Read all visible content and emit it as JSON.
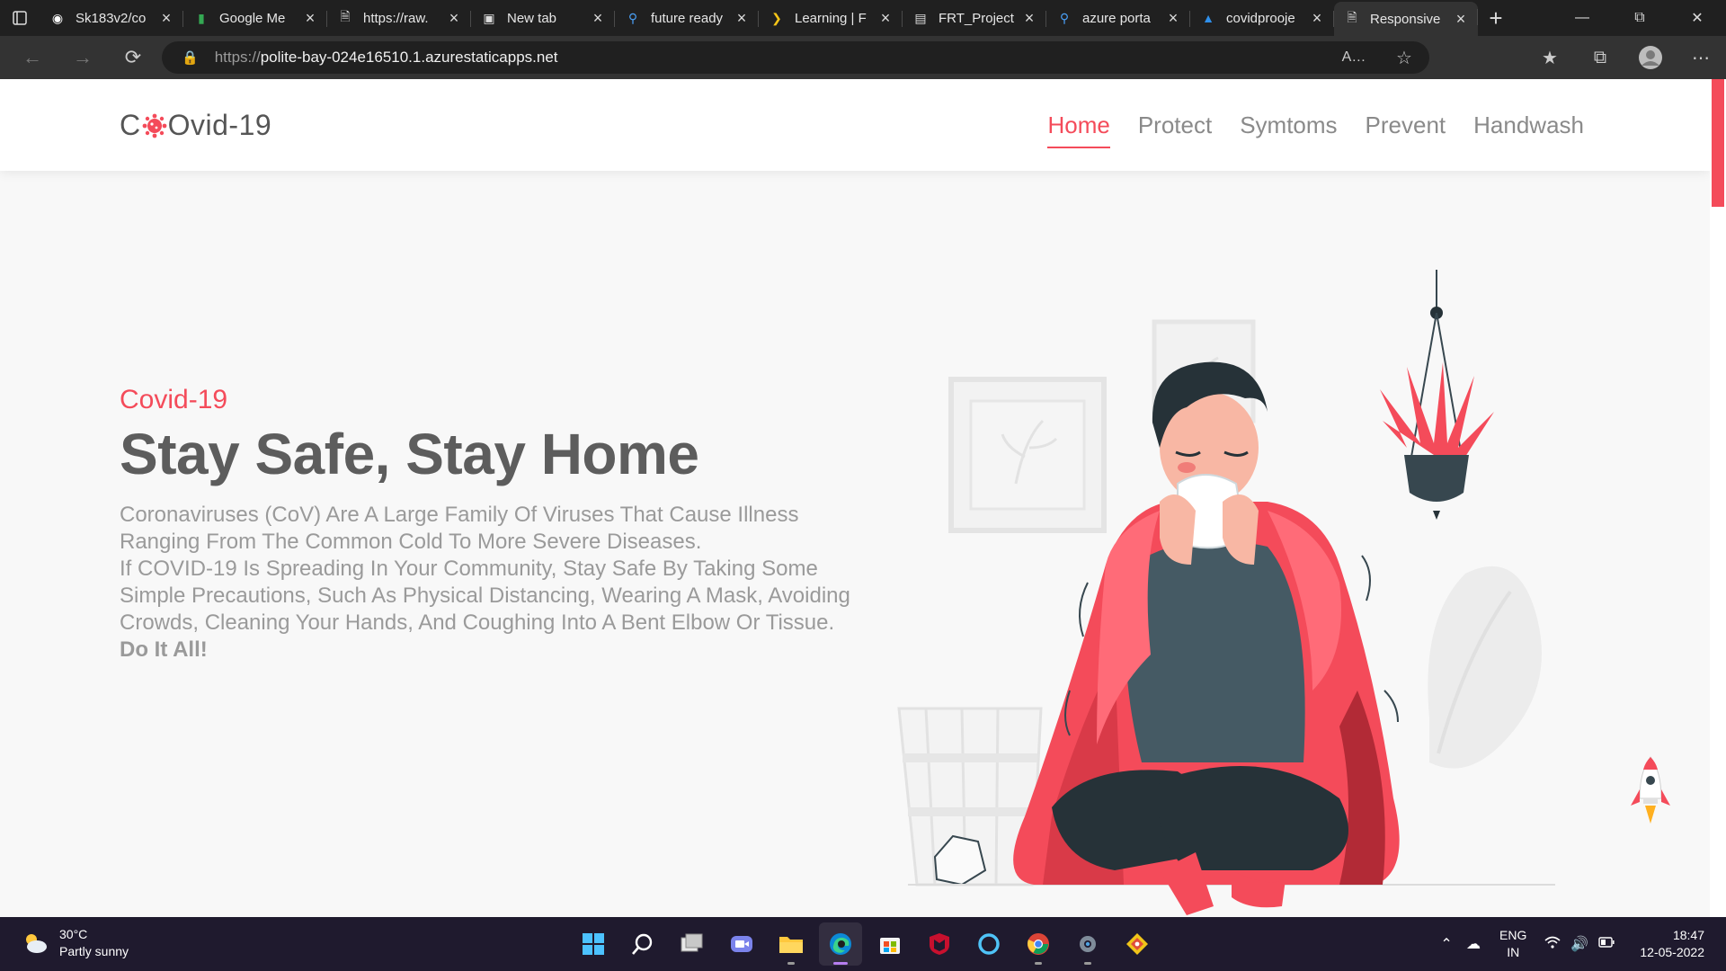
{
  "browser": {
    "tabs": [
      {
        "title": "Sk183v2/co",
        "icon": "github-icon",
        "active": false
      },
      {
        "title": "Google Me",
        "icon": "google-meet-icon",
        "active": false
      },
      {
        "title": "https://raw.",
        "icon": "document-icon",
        "active": false
      },
      {
        "title": "New tab",
        "icon": "new-tab-page-icon",
        "active": false
      },
      {
        "title": "future ready",
        "icon": "search-icon",
        "active": false
      },
      {
        "title": "Learning | F",
        "icon": "learning-icon",
        "active": false
      },
      {
        "title": "FRT_Project",
        "icon": "docs-icon",
        "active": false
      },
      {
        "title": "azure porta",
        "icon": "search-icon",
        "active": false
      },
      {
        "title": "covidprooje",
        "icon": "azure-icon",
        "active": false
      },
      {
        "title": "Responsive",
        "icon": "document-icon",
        "active": true
      }
    ],
    "url_scheme": "https://",
    "url_host": "polite-bay-024e16510.1.azurestaticapps.net"
  },
  "site": {
    "logo_prefix": "C",
    "logo_suffix": "Ovid-19",
    "nav": [
      {
        "label": "Home",
        "active": true
      },
      {
        "label": "Protect",
        "active": false
      },
      {
        "label": "Symtoms",
        "active": false
      },
      {
        "label": "Prevent",
        "active": false
      },
      {
        "label": "Handwash",
        "active": false
      }
    ],
    "accent_color": "#f44b5a"
  },
  "hero": {
    "eyebrow": "Covid-19",
    "title": "Stay Safe, Stay Home",
    "para1": "Coronaviruses (CoV) Are A Large Family Of Viruses That Cause Illness Ranging From The Common Cold To More Severe Diseases.",
    "para2": "If COVID-19 Is Spreading In Your Community, Stay Safe By Taking Some Simple Precautions, Such As Physical Distancing, Wearing A Mask, Avoiding Crowds, Cleaning Your Hands, And Coughing Into A Bent Elbow Or Tissue.",
    "cta": "Do It All!"
  },
  "taskbar": {
    "weather_temp": "30°C",
    "weather_desc": "Partly sunny",
    "lang_top": "ENG",
    "lang_bottom": "IN",
    "time": "18:47",
    "date": "12-05-2022"
  }
}
